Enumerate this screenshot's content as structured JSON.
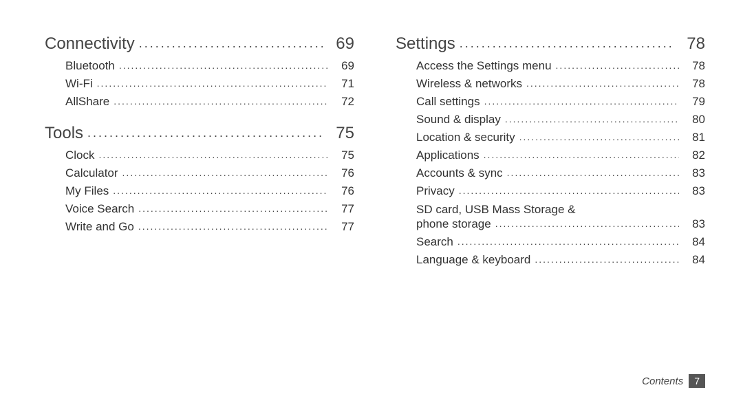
{
  "left": {
    "sections": [
      {
        "title": "Connectivity",
        "page": "69",
        "items": [
          {
            "label": "Bluetooth",
            "page": "69"
          },
          {
            "label": "Wi-Fi",
            "page": "71"
          },
          {
            "label": "AllShare",
            "page": "72"
          }
        ]
      },
      {
        "title": "Tools",
        "page": "75",
        "items": [
          {
            "label": "Clock",
            "page": "75"
          },
          {
            "label": "Calculator",
            "page": "76"
          },
          {
            "label": "My Files",
            "page": "76"
          },
          {
            "label": "Voice Search",
            "page": "77"
          },
          {
            "label": "Write and Go",
            "page": "77"
          }
        ]
      }
    ]
  },
  "right": {
    "sections": [
      {
        "title": "Settings",
        "page": "78",
        "items": [
          {
            "label": "Access the Settings menu",
            "page": "78"
          },
          {
            "label": "Wireless & networks",
            "page": "78"
          },
          {
            "label": "Call settings",
            "page": "79"
          },
          {
            "label": "Sound & display",
            "page": "80"
          },
          {
            "label": "Location & security",
            "page": "81"
          },
          {
            "label": "Applications",
            "page": "82"
          },
          {
            "label": "Accounts & sync",
            "page": "83"
          },
          {
            "label": "Privacy",
            "page": "83"
          },
          {
            "label_lead": "SD card, USB Mass Storage &",
            "label": "phone storage",
            "page": "83"
          },
          {
            "label": "Search",
            "page": "84"
          },
          {
            "label": "Language & keyboard",
            "page": "84"
          }
        ]
      }
    ]
  },
  "footer": {
    "label": "Contents",
    "page": "7"
  }
}
